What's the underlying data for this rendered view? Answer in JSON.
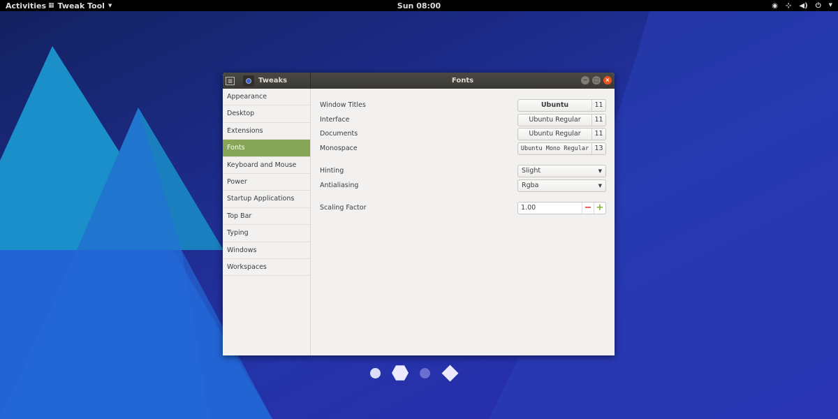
{
  "topbar": {
    "activities": "Activities",
    "app_menu": "Tweak Tool",
    "clock": "Sun 08:00"
  },
  "window": {
    "sidebar_title": "Tweaks",
    "title": "Fonts"
  },
  "sidebar": {
    "items": [
      "Appearance",
      "Desktop",
      "Extensions",
      "Fonts",
      "Keyboard and Mouse",
      "Power",
      "Startup Applications",
      "Top Bar",
      "Typing",
      "Windows",
      "Workspaces"
    ],
    "selected": "Fonts"
  },
  "fonts": {
    "window_titles": {
      "label": "Window Titles",
      "font": "Ubuntu",
      "size": "11"
    },
    "interface": {
      "label": "Interface",
      "font": "Ubuntu Regular",
      "size": "11"
    },
    "documents": {
      "label": "Documents",
      "font": "Ubuntu Regular",
      "size": "11"
    },
    "monospace": {
      "label": "Monospace",
      "font": "Ubuntu Mono Regular",
      "size": "13"
    },
    "hinting": {
      "label": "Hinting",
      "value": "Slight"
    },
    "antialiasing": {
      "label": "Antialiasing",
      "value": "Rgba"
    },
    "scaling": {
      "label": "Scaling Factor",
      "value": "1.00"
    }
  },
  "colors": {
    "accent": "#87a556",
    "titlebar": "#3c3b37",
    "close": "#e9541f"
  }
}
